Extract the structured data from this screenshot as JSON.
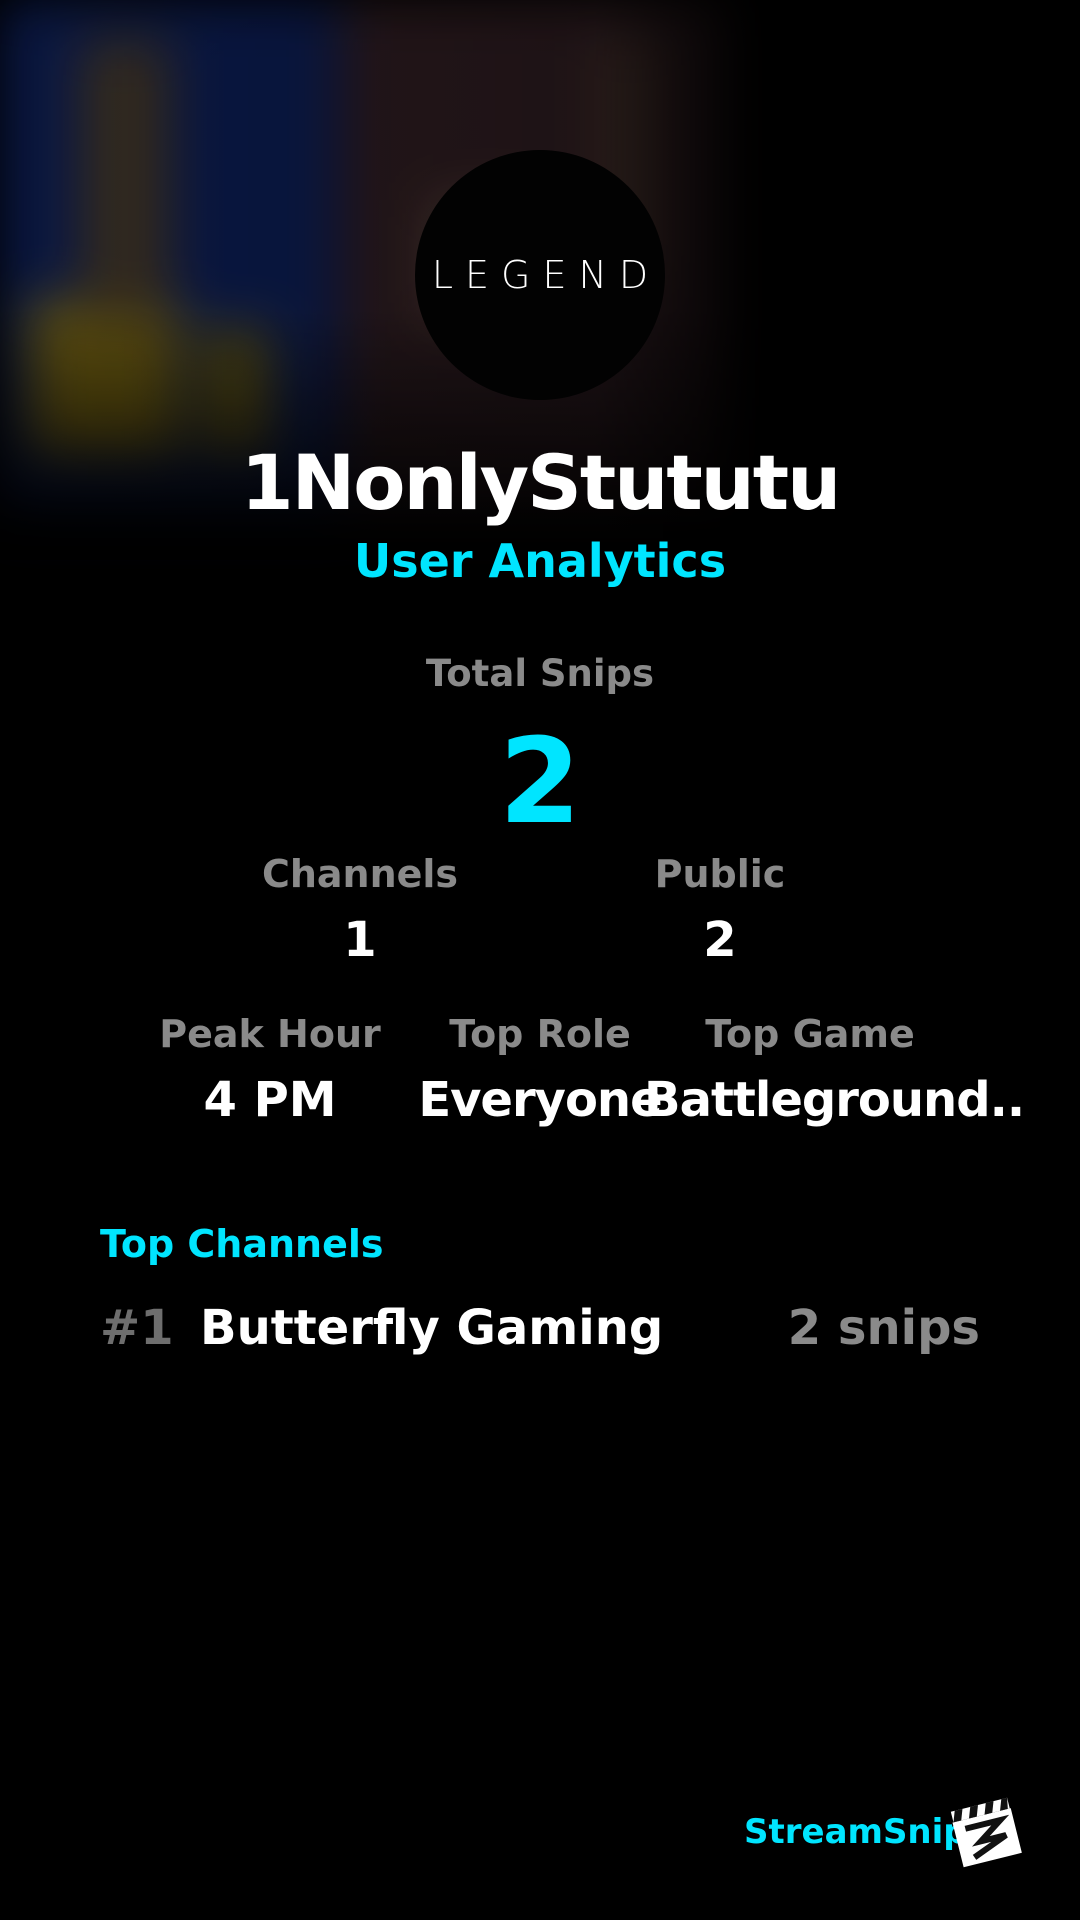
{
  "profile": {
    "avatar_text": "LEGEND",
    "username": "1NonlyStututu",
    "subtitle": "User Analytics"
  },
  "stats": {
    "total_snips": {
      "label": "Total Snips",
      "value": "2"
    },
    "channels": {
      "label": "Channels",
      "value": "1"
    },
    "public": {
      "label": "Public",
      "value": "2"
    },
    "peak_hour": {
      "label": "Peak Hour",
      "value": "4 PM"
    },
    "top_role": {
      "label": "Top Role",
      "value": "Everyone"
    },
    "top_game": {
      "label": "Top Game",
      "value": "Battleground.."
    }
  },
  "top_channels": {
    "title": "Top Channels",
    "items": [
      {
        "rank": "#1",
        "name": "Butterfly Gaming",
        "count": "2 snips"
      }
    ]
  },
  "brand": {
    "name": "StreamSnip",
    "icon": "clapperboard-icon"
  },
  "colors": {
    "accent": "#00e5ff",
    "background": "#000000",
    "muted": "#8a8a8a"
  }
}
